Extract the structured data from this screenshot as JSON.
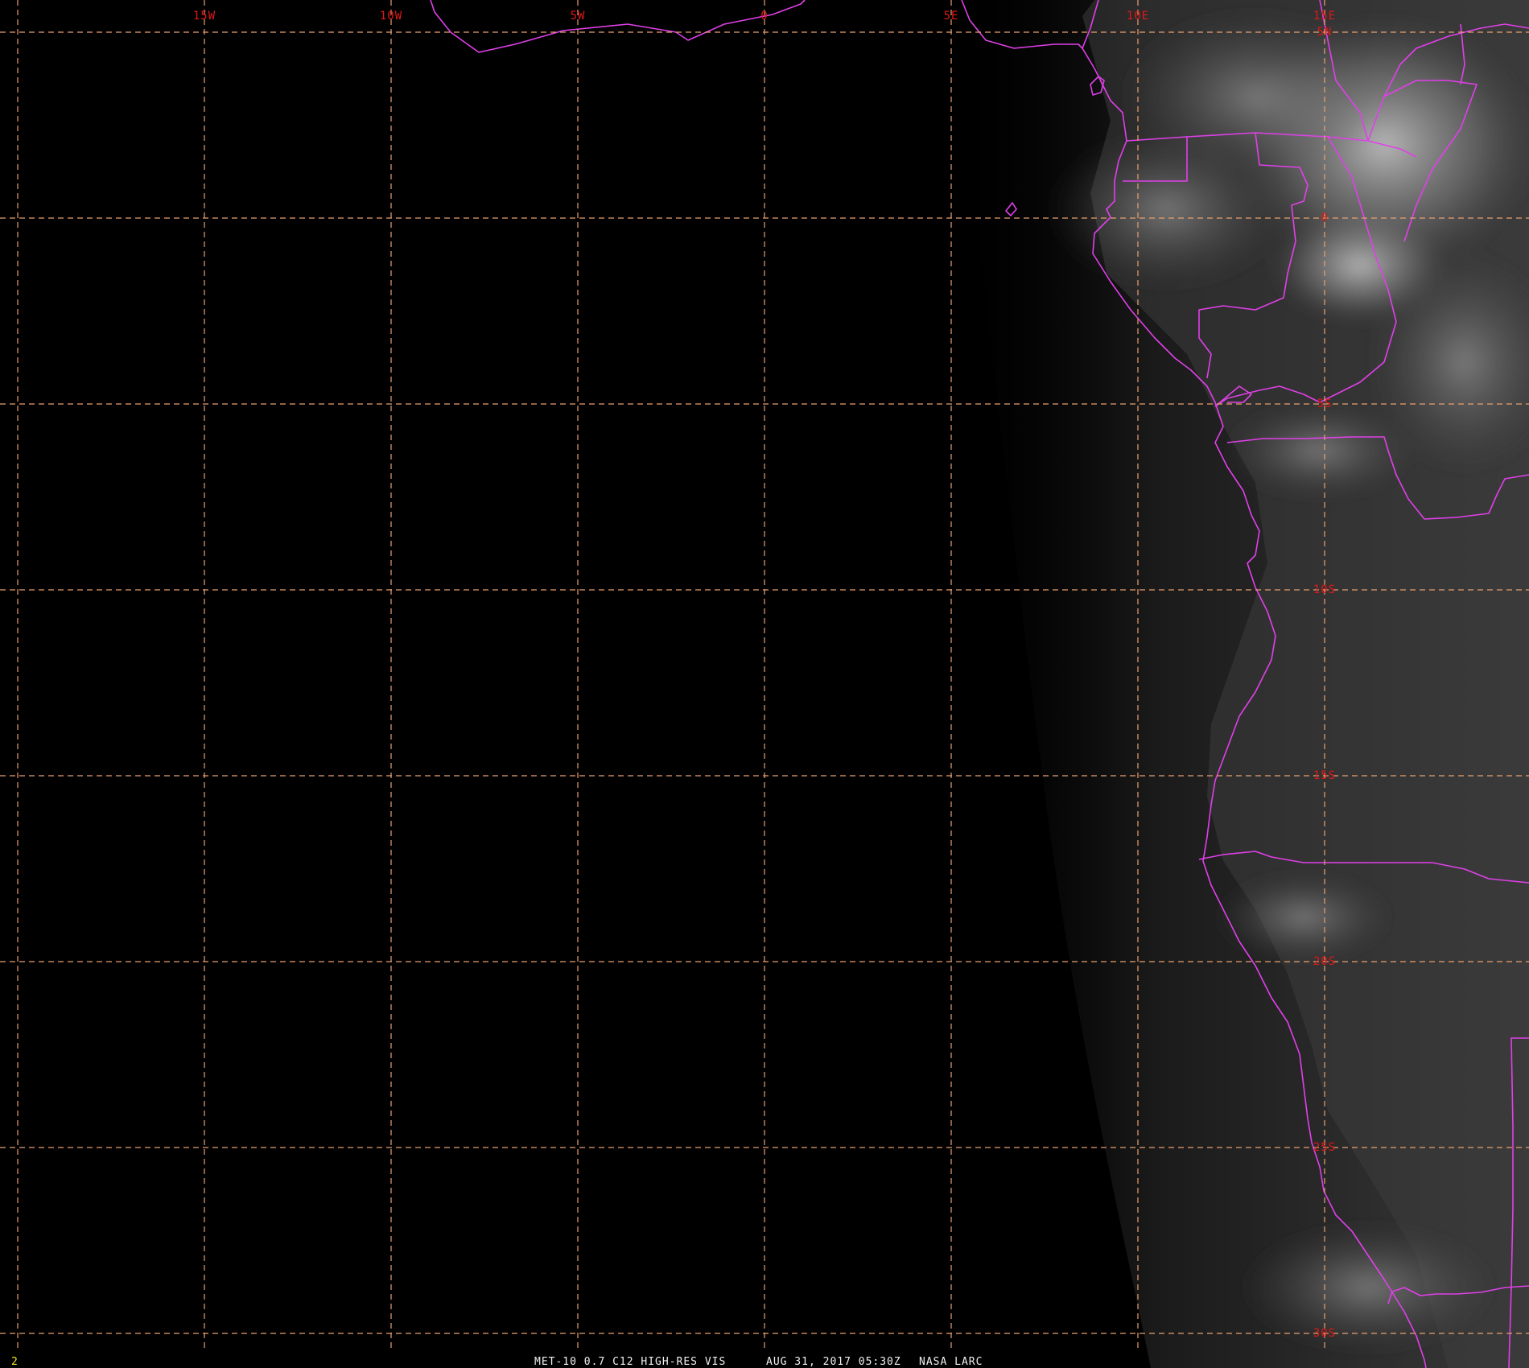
{
  "colors": {
    "grid": "#e8a070",
    "boundary": "#e040e8",
    "label": "#e01818",
    "footer": "#f0f0f0",
    "frame": "#f0e020",
    "background": "#000000"
  },
  "longitude_labels": [
    "15W",
    "10W",
    "5W",
    "0",
    "5E",
    "10E",
    "15E"
  ],
  "latitude_labels": [
    "5N",
    "0",
    "5S",
    "10S",
    "15S",
    "20S",
    "25S",
    "30S"
  ],
  "footer": {
    "frame_number": "2",
    "satellite_product": "MET-10 0.7 C12 HIGH-RES VIS",
    "datetime": "AUG 31, 2017 05:30Z",
    "source": "NASA LARC"
  }
}
